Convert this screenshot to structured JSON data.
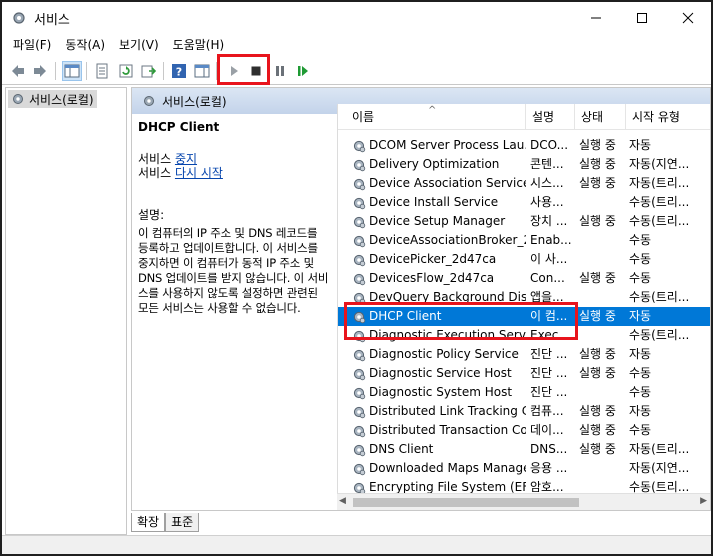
{
  "window": {
    "title": "서비스"
  },
  "menu": [
    "파일(F)",
    "동작(A)",
    "보기(V)",
    "도움말(H)"
  ],
  "tree": {
    "root_label": "서비스(로컬)"
  },
  "pane": {
    "header": "서비스(로컬)",
    "selected_title": "DHCP Client",
    "action1_prefix": "서비스 ",
    "action1_link": "중지",
    "action2_prefix": "서비스 ",
    "action2_link": "다시 시작",
    "description_label": "설명:",
    "description": "이 컴퓨터의 IP 주소 및 DNS 레코드를 등록하고 업데이트합니다. 이 서비스를 중지하면 이 컴퓨터가 동적 IP 주소 및 DNS 업데이트를 받지 않습니다. 이 서비스를 사용하지 않도록 설정하면 관련된 모든 서비스는 사용할 수 없습니다."
  },
  "columns": {
    "name": "이름",
    "desc": "설명",
    "state": "상태",
    "start": "시작 유형"
  },
  "rows": [
    {
      "name": "DCOM Server Process Lau...",
      "desc": "DCO...",
      "state": "실행 중",
      "start": "자동"
    },
    {
      "name": "Delivery Optimization",
      "desc": "콘텐...",
      "state": "실행 중",
      "start": "자동(지연..."
    },
    {
      "name": "Device Association Service",
      "desc": "시스...",
      "state": "실행 중",
      "start": "자동(트리..."
    },
    {
      "name": "Device Install Service",
      "desc": "사용...",
      "state": "",
      "start": "수동(트리..."
    },
    {
      "name": "Device Setup Manager",
      "desc": "장치 ...",
      "state": "실행 중",
      "start": "수동(트리..."
    },
    {
      "name": "DeviceAssociationBroker_2...",
      "desc": "Enab...",
      "state": "",
      "start": "수동"
    },
    {
      "name": "DevicePicker_2d47ca",
      "desc": "이 사...",
      "state": "",
      "start": "수동"
    },
    {
      "name": "DevicesFlow_2d47ca",
      "desc": "Con...",
      "state": "실행 중",
      "start": "수동"
    },
    {
      "name": "DevQuery Background Dis...",
      "desc": "앱을...",
      "state": "",
      "start": "수동(트리..."
    },
    {
      "name": "DHCP Client",
      "desc": "이 컴...",
      "state": "실행 중",
      "start": "자동"
    },
    {
      "name": "Diagnostic Execution Service",
      "desc": "Exec...",
      "state": "",
      "start": "수동(트리..."
    },
    {
      "name": "Diagnostic Policy Service",
      "desc": "진단 ...",
      "state": "실행 중",
      "start": "자동"
    },
    {
      "name": "Diagnostic Service Host",
      "desc": "진단 ...",
      "state": "실행 중",
      "start": "수동"
    },
    {
      "name": "Diagnostic System Host",
      "desc": "진단 ...",
      "state": "",
      "start": "수동"
    },
    {
      "name": "Distributed Link Tracking C...",
      "desc": "컴퓨...",
      "state": "실행 중",
      "start": "자동"
    },
    {
      "name": "Distributed Transaction Co...",
      "desc": "데이...",
      "state": "실행 중",
      "start": "수동"
    },
    {
      "name": "DNS Client",
      "desc": "DNS...",
      "state": "실행 중",
      "start": "자동(트리..."
    },
    {
      "name": "Downloaded Maps Manager",
      "desc": "응용 ...",
      "state": "",
      "start": "자동(지연..."
    },
    {
      "name": "Encrypting File System (EFS)",
      "desc": "암호...",
      "state": "",
      "start": "수동(트리..."
    }
  ],
  "selected_row_index": 9,
  "tabs": [
    "확장",
    "표준"
  ],
  "colors": {
    "selection": "#0078d7",
    "highlight_box": "#e8141c",
    "link": "#0645ad",
    "pane_header": "#c3d3ea"
  }
}
